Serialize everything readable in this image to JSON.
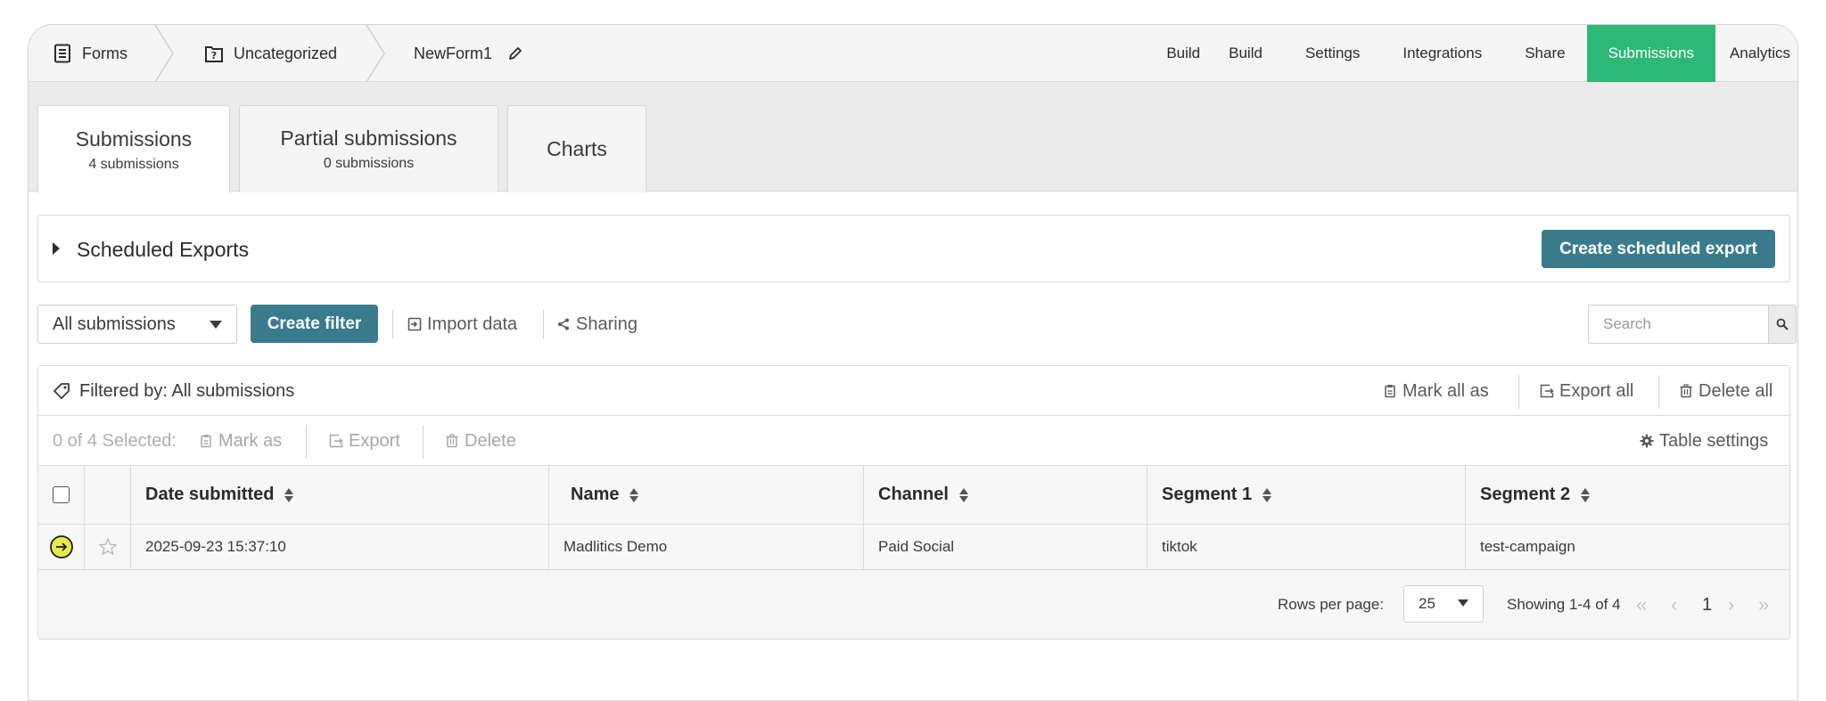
{
  "breadcrumb": {
    "forms": "Forms",
    "category": "Uncategorized",
    "form_name": "NewForm1"
  },
  "nav": {
    "build_plain": "Build",
    "items": [
      "Build",
      "Settings",
      "Integrations",
      "Share",
      "Submissions",
      "Analytics"
    ],
    "active": "Submissions",
    "active_color": "#2db877"
  },
  "tabs": [
    {
      "title": "Submissions",
      "subtitle": "4 submissions"
    },
    {
      "title": "Partial submissions",
      "subtitle": "0 submissions"
    },
    {
      "title": "Charts",
      "subtitle": ""
    }
  ],
  "scheduled": {
    "title": "Scheduled Exports",
    "create_button": "Create scheduled export"
  },
  "toolbar": {
    "filter_select": "All submissions",
    "create_filter": "Create filter",
    "import_data": "Import data",
    "sharing": "Sharing",
    "search_placeholder": "Search"
  },
  "filtered": {
    "label": "Filtered by: All submissions",
    "mark_all_as": "Mark all as",
    "export_all": "Export all",
    "delete_all": "Delete all"
  },
  "selection": {
    "count": "0 of 4 Selected:",
    "mark_as": "Mark as",
    "export": "Export",
    "delete": "Delete",
    "table_settings": "Table settings"
  },
  "table": {
    "columns": [
      "Date submitted",
      "Name",
      "Channel",
      "Segment 1",
      "Segment 2"
    ],
    "rows": [
      {
        "date": "2025-09-23 15:37:10",
        "name": "Madlitics Demo",
        "channel": "Paid Social",
        "segment1": "tiktok",
        "segment2": "test-campaign",
        "status_color": "#e8ea4a"
      }
    ]
  },
  "pager": {
    "rows_per_page_label": "Rows per page:",
    "rows_per_page": "25",
    "showing": "Showing 1-4 of 4",
    "current_page": "1"
  },
  "colors": {
    "primary_button": "#3a7b8e"
  }
}
